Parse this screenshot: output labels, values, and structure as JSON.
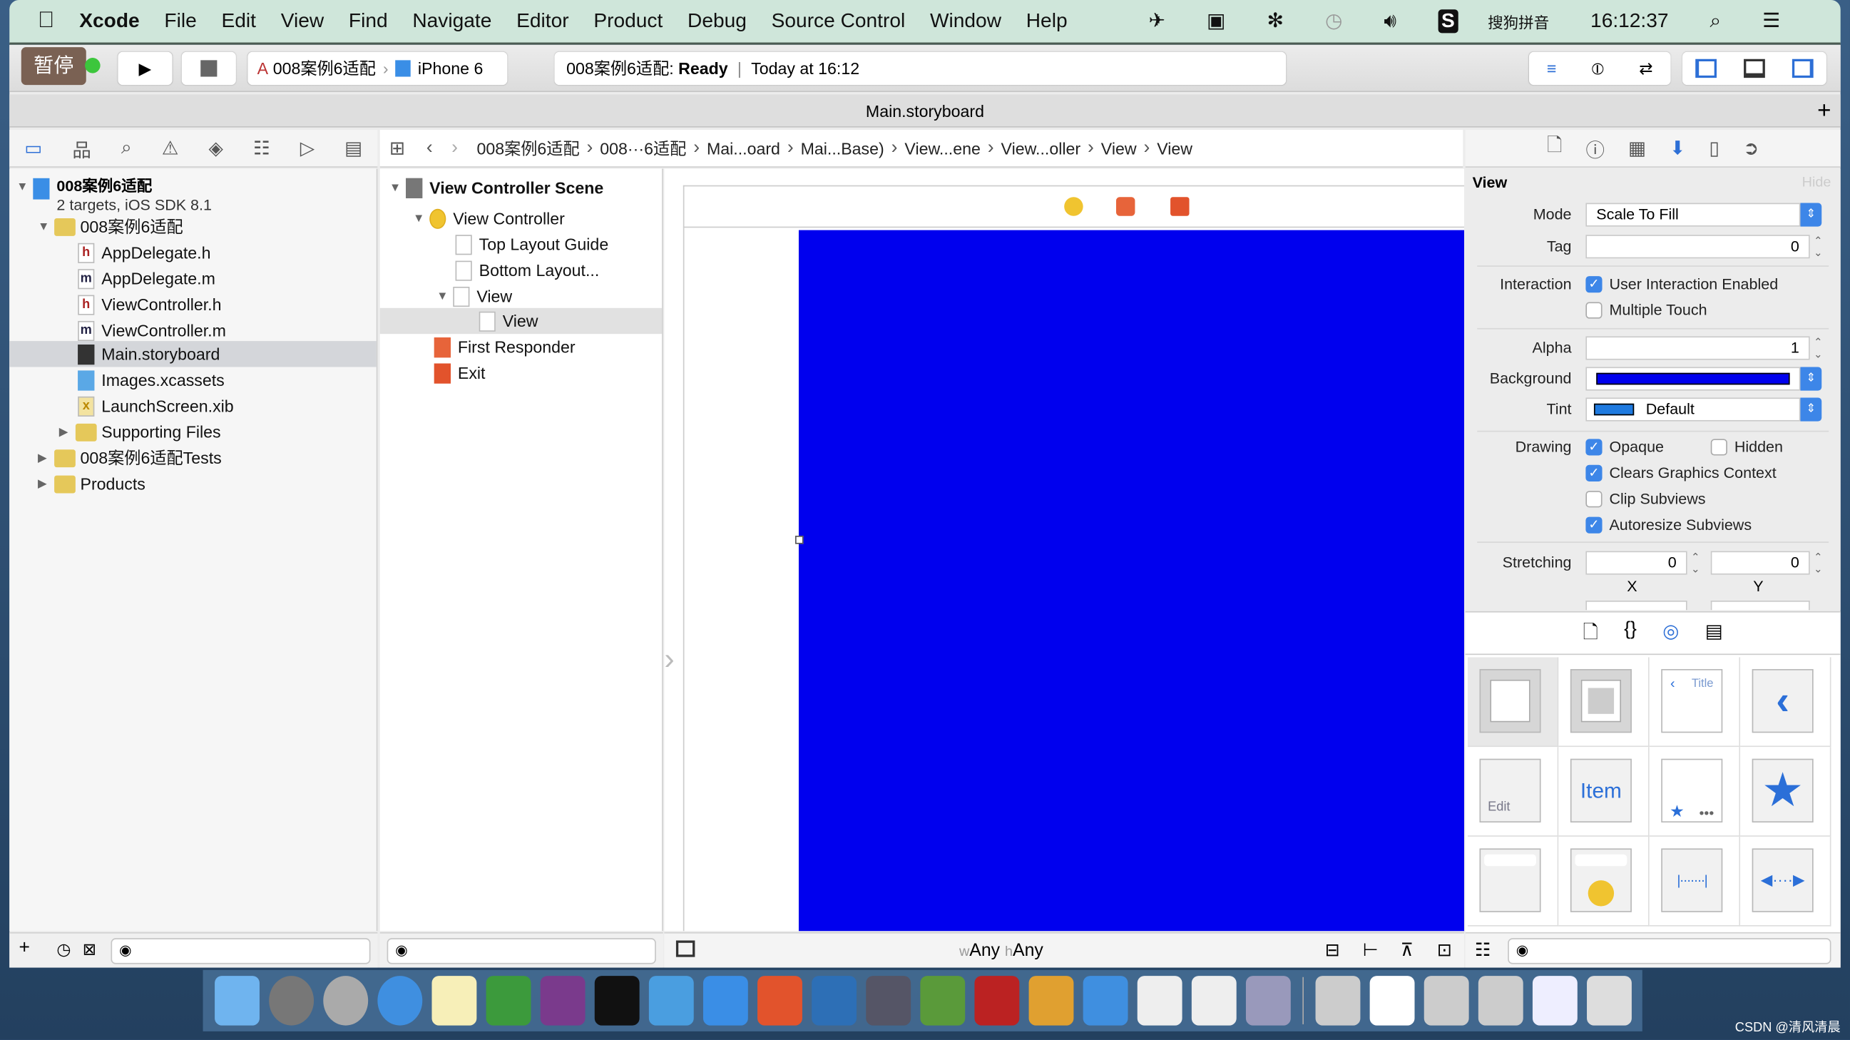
{
  "menubar": {
    "app": "Xcode",
    "items": [
      "File",
      "Edit",
      "View",
      "Find",
      "Navigate",
      "Editor",
      "Product",
      "Debug",
      "Source Control",
      "Window",
      "Help"
    ],
    "input_method": "搜狗拼音",
    "clock": "16:12:37"
  },
  "toolbar": {
    "pause_label": "暂停",
    "scheme": "008案例6适配",
    "device": "iPhone 6",
    "activity_project": "008案例6适配:",
    "activity_status": "Ready",
    "activity_time": "Today at 16:12"
  },
  "tab": {
    "title": "Main.storyboard"
  },
  "jumpbar": [
    "008案例6适配",
    "008···6适配",
    "Mai...oard",
    "Mai...Base)",
    "View...ene",
    "View...oller",
    "View",
    "View"
  ],
  "navigator": {
    "project": {
      "name": "008案例6适配",
      "subtitle": "2 targets, iOS SDK 8.1"
    },
    "items": [
      {
        "label": "008案例6适配",
        "type": "folder",
        "expanded": true
      },
      {
        "label": "AppDelegate.h",
        "type": "h"
      },
      {
        "label": "AppDelegate.m",
        "type": "m"
      },
      {
        "label": "ViewController.h",
        "type": "h"
      },
      {
        "label": "ViewController.m",
        "type": "m"
      },
      {
        "label": "Main.storyboard",
        "type": "storyboard",
        "selected": true
      },
      {
        "label": "Images.xcassets",
        "type": "assets"
      },
      {
        "label": "LaunchScreen.xib",
        "type": "xib"
      },
      {
        "label": "Supporting Files",
        "type": "folder"
      },
      {
        "label": "008案例6适配Tests",
        "type": "folder"
      },
      {
        "label": "Products",
        "type": "folder"
      }
    ]
  },
  "outline": {
    "scene": "View Controller Scene",
    "items": [
      "View Controller",
      "Top Layout Guide",
      "Bottom Layout...",
      "View",
      "View",
      "First Responder",
      "Exit"
    ]
  },
  "canvas": {
    "view_background": "#0000ee",
    "size_class_w": "Any",
    "size_class_h": "Any",
    "w_prefix": "w",
    "h_prefix": "h"
  },
  "inspector": {
    "section": "View",
    "hide": "Hide",
    "mode_label": "Mode",
    "mode": "Scale To Fill",
    "tag_label": "Tag",
    "tag": "0",
    "interaction_label": "Interaction",
    "user_interaction": "User Interaction Enabled",
    "user_interaction_checked": true,
    "multiple_touch": "Multiple Touch",
    "multiple_touch_checked": false,
    "alpha_label": "Alpha",
    "alpha": "1",
    "background_label": "Background",
    "background_color": "#0000ee",
    "tint_label": "Tint",
    "tint": "Default",
    "tint_color": "#1e7ae0",
    "drawing_label": "Drawing",
    "opaque": "Opaque",
    "opaque_checked": true,
    "hidden": "Hidden",
    "hidden_checked": false,
    "clears": "Clears Graphics Context",
    "clears_checked": true,
    "clip": "Clip Subviews",
    "clip_checked": false,
    "autoresize": "Autoresize Subviews",
    "autoresize_checked": true,
    "stretching_label": "Stretching",
    "stretch_x": "0",
    "stretch_y": "0",
    "x_label": "X",
    "y_label": "Y"
  },
  "library": {
    "title_thumb": "Title",
    "edit_thumb": "Edit",
    "item_thumb": "Item"
  },
  "watermark": "CSDN @清风清晨"
}
